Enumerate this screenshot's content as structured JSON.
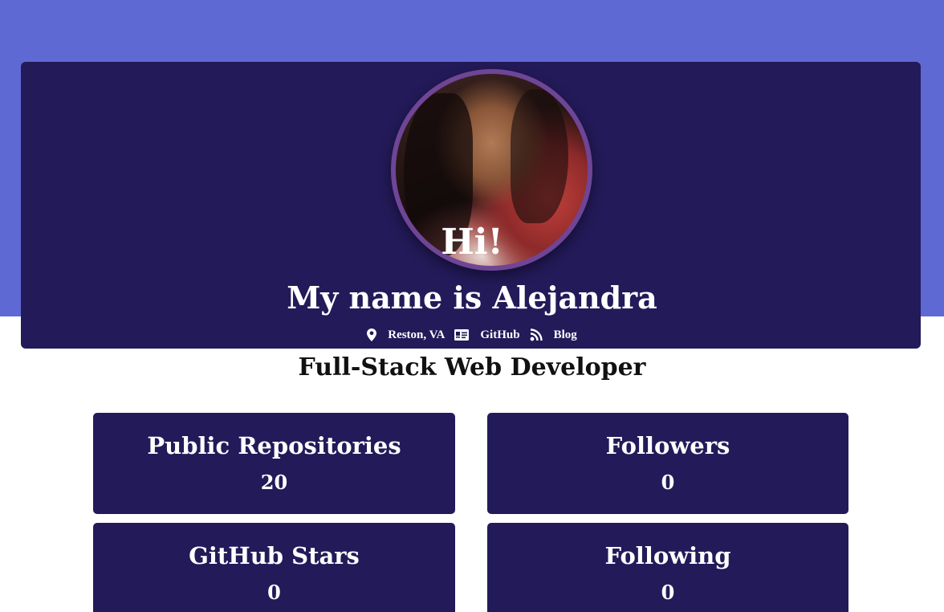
{
  "header": {
    "greeting": "Hi!",
    "name_line": "My name is Alejandra",
    "links": [
      {
        "icon": "map-marker-icon",
        "label": "Reston, VA"
      },
      {
        "icon": "id-card-icon",
        "label": "GitHub"
      },
      {
        "icon": "rss-icon",
        "label": "Blog"
      }
    ]
  },
  "subtitle": "Full-Stack Web Developer",
  "stats": [
    {
      "label": "Public Repositories",
      "value": "20"
    },
    {
      "label": "Followers",
      "value": "0"
    },
    {
      "label": "GitHub Stars",
      "value": "0"
    },
    {
      "label": "Following",
      "value": "0"
    }
  ],
  "colors": {
    "band": "#5f69d3",
    "card": "#231a59",
    "avatar_border": "#6f4596"
  }
}
